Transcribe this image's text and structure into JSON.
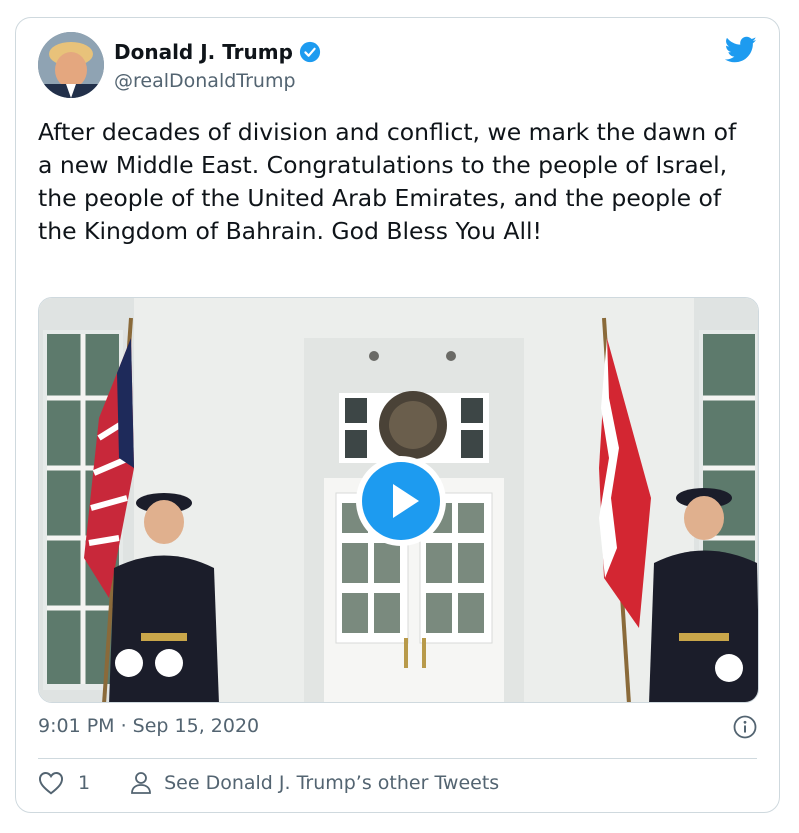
{
  "tweet": {
    "author_name": "Donald J. Trump",
    "author_handle": "@realDonaldTrump",
    "verified": true,
    "text": "After decades of division and conflict, we mark the dawn of a new Middle East. Congratulations to the people of Israel, the people of the United Arab Emirates, and the people of the Kingdom of Bahrain. God Bless You All!",
    "timestamp": "9:01 PM · Sep 15, 2020",
    "like_count": "1",
    "other_tweets_label": "See Donald J. Trump’s other Tweets"
  },
  "icons": {
    "verified": "verified-badge-icon",
    "brand": "twitter-bird-icon",
    "play": "play-icon",
    "info": "info-icon",
    "like": "heart-icon",
    "profile": "person-icon"
  },
  "colors": {
    "brand_blue": "#1d9bf0",
    "text_primary": "#0f1419",
    "text_secondary": "#536471",
    "border": "#cfd9de"
  }
}
